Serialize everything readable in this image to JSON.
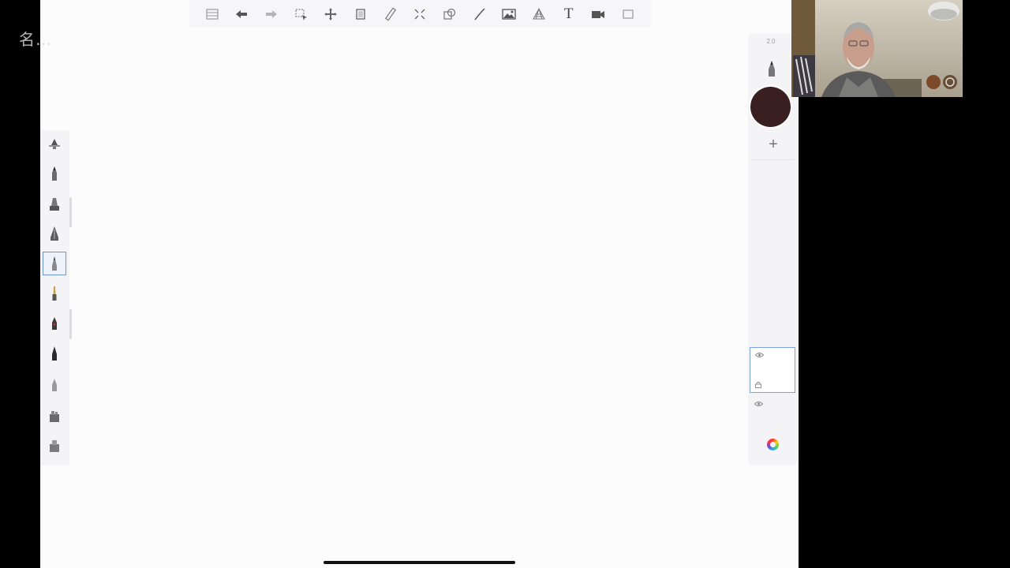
{
  "watermark": {
    "text": "名…"
  },
  "toolbar": {
    "items": [
      {
        "name": "layers-icon"
      },
      {
        "name": "undo-icon"
      },
      {
        "name": "redo-icon"
      },
      {
        "name": "selection-icon"
      },
      {
        "name": "transform-icon"
      },
      {
        "name": "crop-icon"
      },
      {
        "name": "ruler-icon"
      },
      {
        "name": "symmetry-icon"
      },
      {
        "name": "shape-guide-icon"
      },
      {
        "name": "stroke-icon"
      },
      {
        "name": "image-icon"
      },
      {
        "name": "perspective-icon"
      },
      {
        "name": "text-icon",
        "label": "T"
      },
      {
        "name": "video-icon"
      },
      {
        "name": "fullscreen-icon"
      }
    ]
  },
  "brushes": {
    "selected_index": 4,
    "items": [
      {
        "name": "brush-ruler-icon"
      },
      {
        "name": "brush-pencil-icon"
      },
      {
        "name": "brush-marker-icon"
      },
      {
        "name": "brush-airbrush-icon"
      },
      {
        "name": "brush-ballpoint-icon"
      },
      {
        "name": "brush-paintbrush-icon"
      },
      {
        "name": "brush-ink-icon"
      },
      {
        "name": "brush-felt-tip-icon"
      },
      {
        "name": "brush-soft-eraser-icon"
      },
      {
        "name": "brush-smudge-icon"
      },
      {
        "name": "brush-blender-icon"
      }
    ]
  },
  "right_panel": {
    "brush_size": "2.0",
    "current_color": "#3a1f20",
    "add_label": "+"
  },
  "colors": {
    "canvas": "#fdfcfd",
    "panel": "#f4f3f5",
    "selection_accent": "#6f93d6"
  }
}
